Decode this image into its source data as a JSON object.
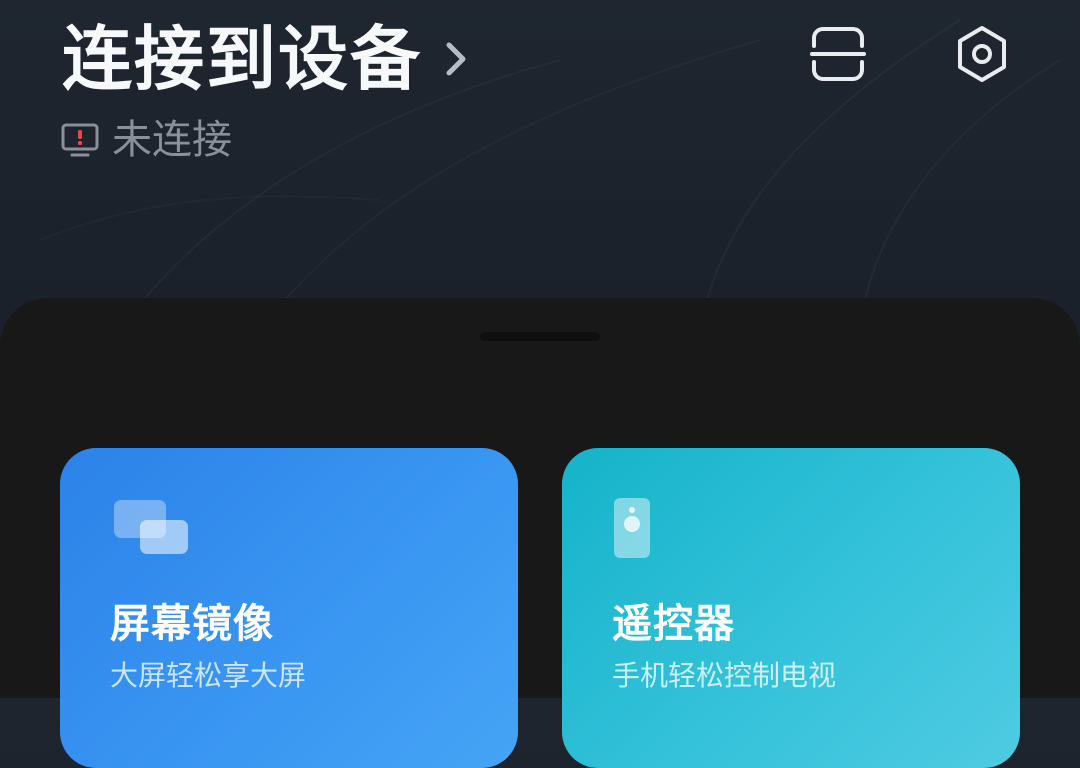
{
  "header": {
    "title": "连接到设备",
    "status_text": "未连接",
    "icons": {
      "title_chevron": "chevron-right-icon",
      "status": "monitor-alert-icon",
      "scan": "scan-icon",
      "settings": "settings-hexagon-icon"
    }
  },
  "cards": [
    {
      "title": "屏幕镜像",
      "subtitle": "大屏轻松享大屏",
      "icon": "screen-mirror-icon",
      "color": "#2c82e8"
    },
    {
      "title": "遥控器",
      "subtitle": "手机轻松控制电视",
      "icon": "remote-control-icon",
      "color": "#15b3c9"
    }
  ],
  "colors": {
    "background": "#1c222b",
    "sheet": "#181818",
    "status_alert": "#e5484d"
  }
}
